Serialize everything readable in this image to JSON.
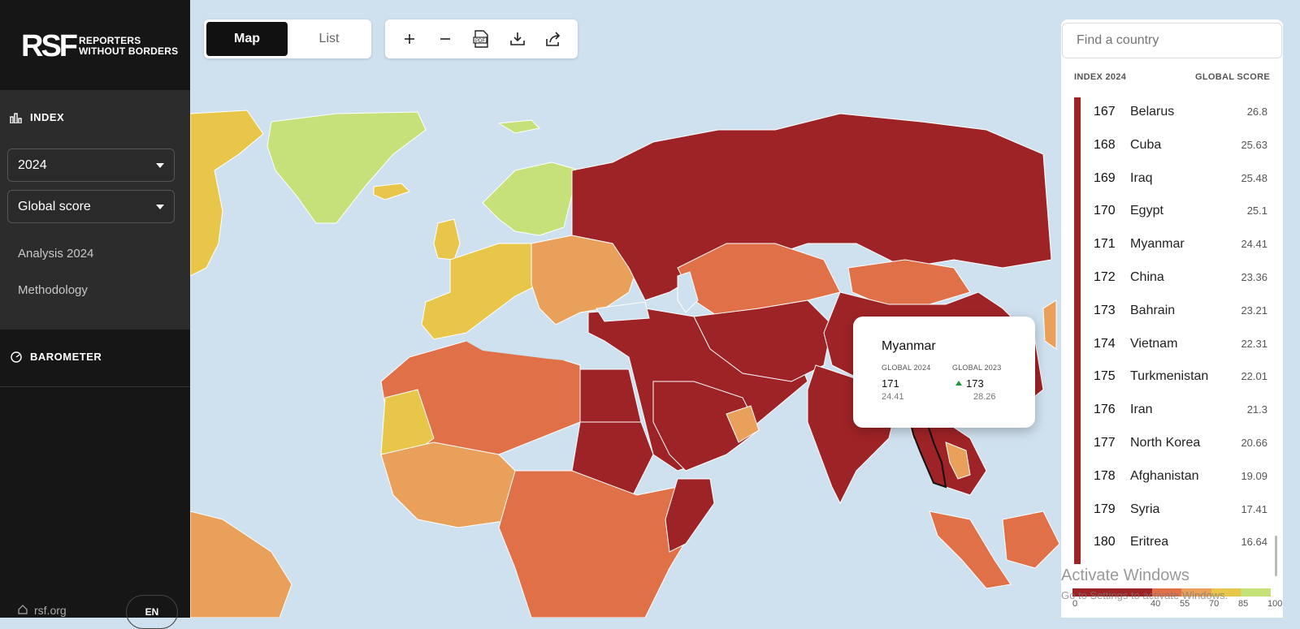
{
  "brand": {
    "mark": "RSF",
    "name_line1": "REPORTERS",
    "name_line2": "WITHOUT BORDERS"
  },
  "sidebar": {
    "index_label": "INDEX",
    "year_select": "2024",
    "metric_select": "Global score",
    "links": [
      "Analysis 2024",
      "Methodology"
    ],
    "barometer_label": "BAROMETER",
    "footer_link": "rsf.org",
    "language": "EN"
  },
  "view_toggle": {
    "map": "Map",
    "list": "List",
    "active": "Map"
  },
  "toolbar": {
    "zoom_in": "+",
    "zoom_out": "−",
    "pdf": "PDF",
    "download": "download",
    "share": "share"
  },
  "tooltip": {
    "country": "Myanmar",
    "col1_label": "GLOBAL 2024",
    "col2_label": "GLOBAL 2023",
    "rank_2024": "171",
    "score_2024": "24.41",
    "rank_2023": "173",
    "score_2023": "28.26",
    "trend": "up"
  },
  "ranking_panel": {
    "search_placeholder": "Find a country",
    "col_left": "INDEX 2024",
    "col_right": "GLOBAL SCORE",
    "rows": [
      {
        "rank": "167",
        "country": "Belarus",
        "score": "26.8"
      },
      {
        "rank": "168",
        "country": "Cuba",
        "score": "25.63"
      },
      {
        "rank": "169",
        "country": "Iraq",
        "score": "25.48"
      },
      {
        "rank": "170",
        "country": "Egypt",
        "score": "25.1"
      },
      {
        "rank": "171",
        "country": "Myanmar",
        "score": "24.41"
      },
      {
        "rank": "172",
        "country": "China",
        "score": "23.36"
      },
      {
        "rank": "173",
        "country": "Bahrain",
        "score": "23.21"
      },
      {
        "rank": "174",
        "country": "Vietnam",
        "score": "22.31"
      },
      {
        "rank": "175",
        "country": "Turkmenistan",
        "score": "22.01"
      },
      {
        "rank": "176",
        "country": "Iran",
        "score": "21.3"
      },
      {
        "rank": "177",
        "country": "North Korea",
        "score": "20.66"
      },
      {
        "rank": "178",
        "country": "Afghanistan",
        "score": "19.09"
      },
      {
        "rank": "179",
        "country": "Syria",
        "score": "17.41"
      },
      {
        "rank": "180",
        "country": "Eritrea",
        "score": "16.64"
      }
    ]
  },
  "legend": {
    "ticks": [
      "0",
      "40",
      "55",
      "70",
      "85",
      "100"
    ],
    "colors": [
      "#9e2326",
      "#e07048",
      "#e8a05a",
      "#e8c64a",
      "#c6e07a"
    ]
  },
  "watermark": {
    "title": "Activate Windows",
    "subtitle": "Go to Settings to activate Windows."
  },
  "map_colors": {
    "very_serious": "#9e2326",
    "difficult": "#e07048",
    "problematic": "#e8a05a",
    "satisfactory": "#e8c64a",
    "good": "#c6e07a",
    "ocean": "#cfe0ee"
  }
}
